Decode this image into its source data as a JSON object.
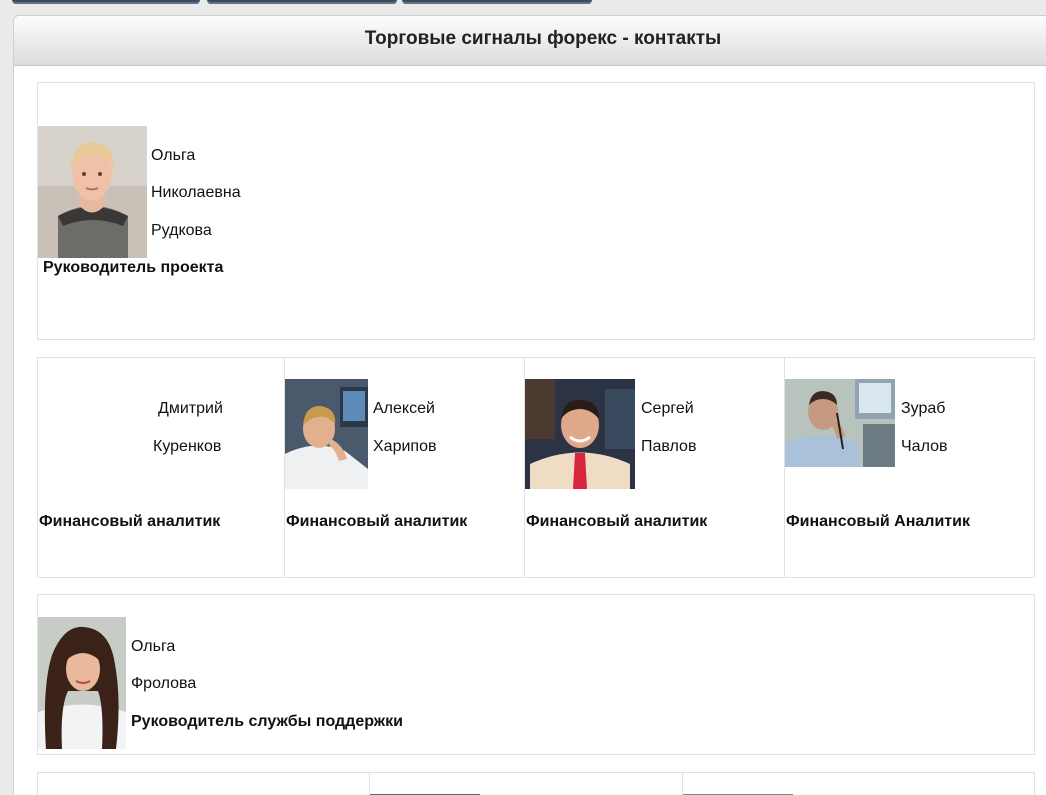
{
  "header": {
    "title": "Торговые сигналы форекс - контакты"
  },
  "leader": {
    "first_name": "Ольга",
    "middle_name": "Николаевна",
    "last_name": "Рудкова",
    "role": "Руководитель проекта"
  },
  "analysts": [
    {
      "first_name": "Дмитрий",
      "last_name": "Куренков",
      "role": "Финансовый аналитик"
    },
    {
      "first_name": "Алексей",
      "last_name": "Харипов",
      "role": "Финансовый аналитик"
    },
    {
      "first_name": "Сергей",
      "last_name": "Павлов",
      "role": "Финансовый аналитик"
    },
    {
      "first_name": "Зураб",
      "last_name": "Чалов",
      "role": "Финансовый Аналитик"
    }
  ],
  "support": {
    "first_name": "Ольга",
    "last_name": "Фролова",
    "role": "Руководитель службы поддержки"
  }
}
